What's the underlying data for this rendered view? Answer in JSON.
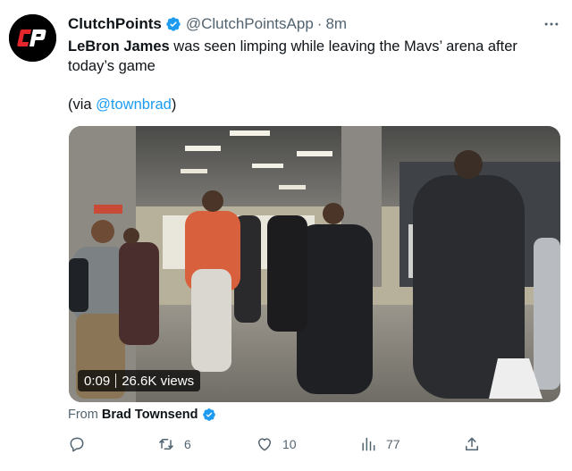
{
  "author": {
    "display_name": "ClutchPoints",
    "handle": "@ClutchPointsApp",
    "separator": "·",
    "time": "8m",
    "avatar_icon": "clutchpoints-logo-icon",
    "verified_color": "#1d9bf0"
  },
  "tweet": {
    "bold_name": "LeBron James",
    "text_rest": " was seen limping while leaving the Mavs’ arena after today’s game",
    "via_prefix": "(via ",
    "via_link": "@townbrad",
    "via_suffix": ")"
  },
  "video": {
    "duration": "0:09",
    "views": "26.6K views"
  },
  "source": {
    "prefix": "From",
    "author": "Brad Townsend"
  },
  "actions": {
    "reply": {
      "icon": "reply-icon",
      "count": ""
    },
    "retweet": {
      "icon": "retweet-icon",
      "count": "6"
    },
    "like": {
      "icon": "heart-icon",
      "count": "10"
    },
    "views": {
      "icon": "views-chart-icon",
      "count": "77"
    },
    "share": {
      "icon": "share-icon",
      "count": ""
    }
  },
  "colors": {
    "link": "#1d9bf0",
    "muted": "#536471",
    "text": "#0f1419",
    "brand_red": "#e4262c"
  }
}
